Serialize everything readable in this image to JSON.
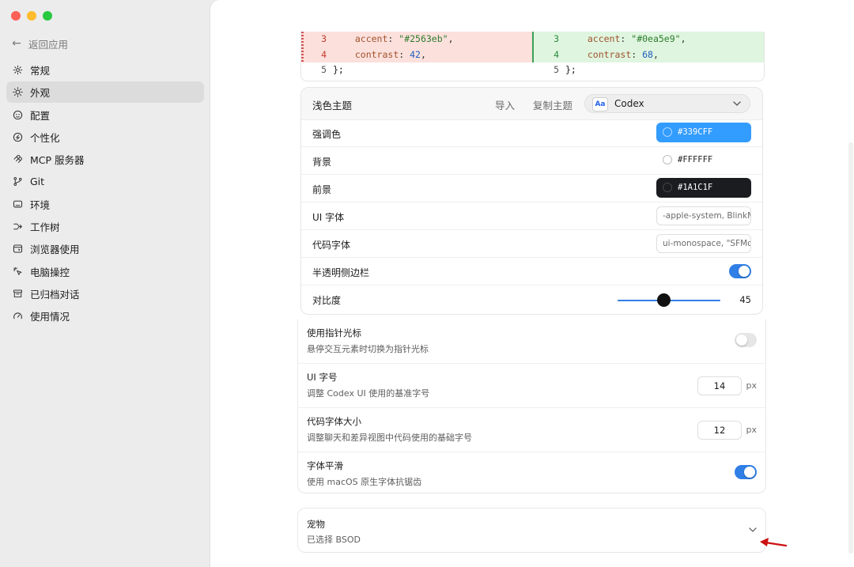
{
  "sidebar": {
    "back_label": "返回应用",
    "items": [
      {
        "label": "常规",
        "icon": "gear-icon"
      },
      {
        "label": "外观",
        "icon": "sun-icon",
        "active": true
      },
      {
        "label": "配置",
        "icon": "config-icon"
      },
      {
        "label": "个性化",
        "icon": "personalize-icon"
      },
      {
        "label": "MCP 服务器",
        "icon": "mcp-icon"
      },
      {
        "label": "Git",
        "icon": "git-branch-icon"
      },
      {
        "label": "环境",
        "icon": "monitor-icon"
      },
      {
        "label": "工作树",
        "icon": "worktree-icon"
      },
      {
        "label": "浏览器使用",
        "icon": "browser-icon"
      },
      {
        "label": "电脑操控",
        "icon": "pointer-icon"
      },
      {
        "label": "已归档对话",
        "icon": "archive-icon"
      },
      {
        "label": "使用情况",
        "icon": "gauge-icon"
      }
    ]
  },
  "code_diff": {
    "left": [
      {
        "num": "3",
        "text": "  accent: \"#2563eb\",",
        "key": "accent",
        "value": "\"#2563eb\""
      },
      {
        "num": "4",
        "text": "  contrast: 42,",
        "key": "contrast",
        "value": "42"
      },
      {
        "num": "5",
        "text": "};"
      }
    ],
    "right": [
      {
        "num": "3",
        "text": "  accent: \"#0ea5e9\",",
        "key": "accent",
        "value": "\"#0ea5e9\""
      },
      {
        "num": "4",
        "text": "  contrast: 68,",
        "key": "contrast",
        "value": "68"
      },
      {
        "num": "5",
        "text": "};"
      }
    ]
  },
  "theme": {
    "title": "浅色主题",
    "import_label": "导入",
    "copy_label": "复制主题",
    "selected_theme": "Codex",
    "selected_badge": "Aa",
    "accent_label": "强调色",
    "accent_value": "#339CFF",
    "background_label": "背景",
    "background_value": "#FFFFFF",
    "foreground_label": "前景",
    "foreground_value": "#1A1C1F",
    "ui_font_label": "UI 字体",
    "ui_font_value": "-apple-system, BlinkMacSystemFont",
    "code_font_label": "代码字体",
    "code_font_value": "ui-monospace, \"SFMono-Regular\"",
    "translucent_label": "半透明侧边栏",
    "translucent_on": true,
    "contrast_label": "对比度",
    "contrast_value": "45"
  },
  "settings": {
    "pointer_title": "使用指针光标",
    "pointer_desc": "悬停交互元素时切换为指针光标",
    "pointer_on": false,
    "ui_size_title": "UI 字号",
    "ui_size_desc": "调整 Codex UI 使用的基准字号",
    "ui_size_value": "14",
    "ui_size_unit": "px",
    "code_size_title": "代码字体大小",
    "code_size_desc": "调整聊天和差异视图中代码使用的基础字号",
    "code_size_value": "12",
    "code_size_unit": "px",
    "smoothing_title": "字体平滑",
    "smoothing_desc": "使用 macOS 原生字体抗锯齿",
    "smoothing_on": true
  },
  "pet": {
    "title": "宠物",
    "desc": "已选择 BSOD"
  },
  "colors": {
    "accent": "#2f7fe6",
    "accent_pill": "#339CFF",
    "foreground_pill": "#1A1C1F",
    "arrow": "#cc1111"
  }
}
